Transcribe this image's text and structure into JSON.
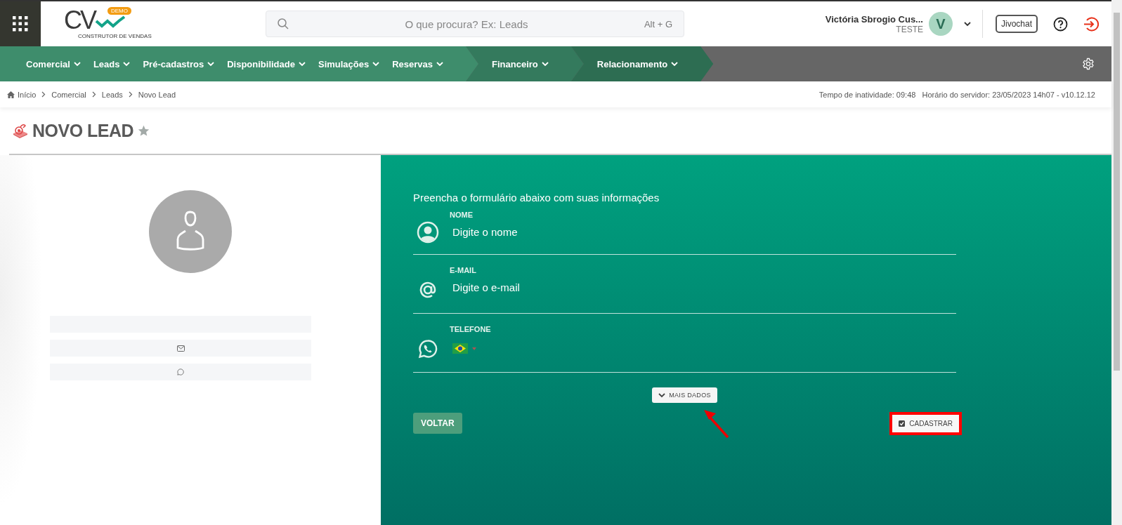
{
  "header": {
    "logo": {
      "letters": "CV",
      "badge": "DEMO",
      "tagline": "CONSTRUTOR DE VENDAS"
    },
    "search": {
      "placeholder": "O que procura? Ex: Leads",
      "shortcut": "Alt + G"
    },
    "user": {
      "name": "Victória Sbrogio Cus...",
      "role": "TESTE",
      "initial": "V"
    },
    "chat_button": "Jivochat"
  },
  "nav": {
    "groups": [
      {
        "items": [
          "Comercial",
          "Leads",
          "Pré-cadastros",
          "Disponibilidade",
          "Simulações",
          "Reservas"
        ]
      },
      {
        "items": [
          "Financeiro"
        ]
      },
      {
        "items": [
          "Relacionamento"
        ]
      }
    ]
  },
  "breadcrumb": [
    "Início",
    "Comercial",
    "Leads",
    "Novo Lead"
  ],
  "status": "Tempo de inatividade: 09:48   Horário do servidor: 23/05/2023 14h07 - v10.12.12",
  "page_title": "NOVO LEAD",
  "favorite": false,
  "profile_rows": [
    {
      "kind": "name"
    },
    {
      "kind": "email"
    },
    {
      "kind": "phone"
    }
  ],
  "form": {
    "intro": "Preencha o formulário abaixo com suas informações",
    "fields": [
      {
        "kind": "name",
        "label": "NOME",
        "placeholder": "Digite o nome"
      },
      {
        "kind": "email",
        "label": "E-MAIL",
        "placeholder": "Digite o e-mail"
      },
      {
        "kind": "phone",
        "label": "TELEFONE"
      }
    ],
    "more_button": "MAIS DADOS",
    "back_button": "VOLTAR",
    "submit_button": {
      "label": "CADASTRAR",
      "highlighted": true
    },
    "pointer_arrow": true
  }
}
